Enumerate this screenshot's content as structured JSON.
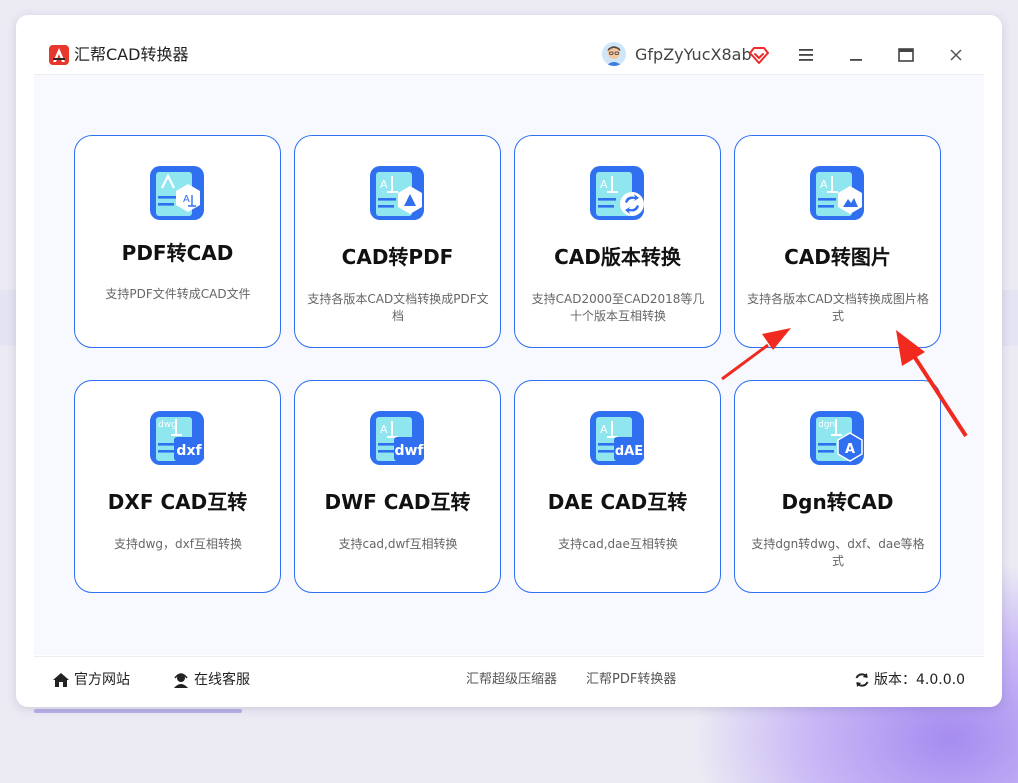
{
  "app": {
    "title": "汇帮CAD转换器"
  },
  "user": {
    "name": "GfpZyYucX8ab"
  },
  "cards": [
    {
      "title": "PDF转CAD",
      "desc": "支持PDF文件转成CAD文件",
      "icon": "pdf-to-cad-icon"
    },
    {
      "title": "CAD转PDF",
      "desc": "支持各版本CAD文档转换成PDF文档",
      "icon": "cad-to-pdf-icon"
    },
    {
      "title": "CAD版本转换",
      "desc": "支持CAD2000至CAD2018等几十个版本互相转换",
      "icon": "cad-version-convert-icon"
    },
    {
      "title": "CAD转图片",
      "desc": "支持各版本CAD文档转换成图片格式",
      "icon": "cad-to-image-icon"
    },
    {
      "title": "DXF CAD互转",
      "desc": "支持dwg，dxf互相转换",
      "icon": "dxf-icon",
      "badge": "dxf",
      "small": "dwg"
    },
    {
      "title": "DWF CAD互转",
      "desc": "支持cad,dwf互相转换",
      "icon": "dwf-icon",
      "badge": "dwf"
    },
    {
      "title": "DAE CAD互转",
      "desc": "支持cad,dae互相转换",
      "icon": "dae-icon",
      "badge": "dAE"
    },
    {
      "title": "Dgn转CAD",
      "desc": "支持dgn转dwg、dxf、dae等格式",
      "icon": "dgn-icon",
      "badge": "A",
      "small": "dgn"
    }
  ],
  "footer": {
    "website": "官方网站",
    "service": "在线客服",
    "link1": "汇帮超级压缩器",
    "link2": "汇帮PDF转换器",
    "version": "版本：4.0.0.0"
  },
  "colors": {
    "accent": "#2f6ff0",
    "arrow": "#f02a1e",
    "logo": "#e8382b"
  }
}
